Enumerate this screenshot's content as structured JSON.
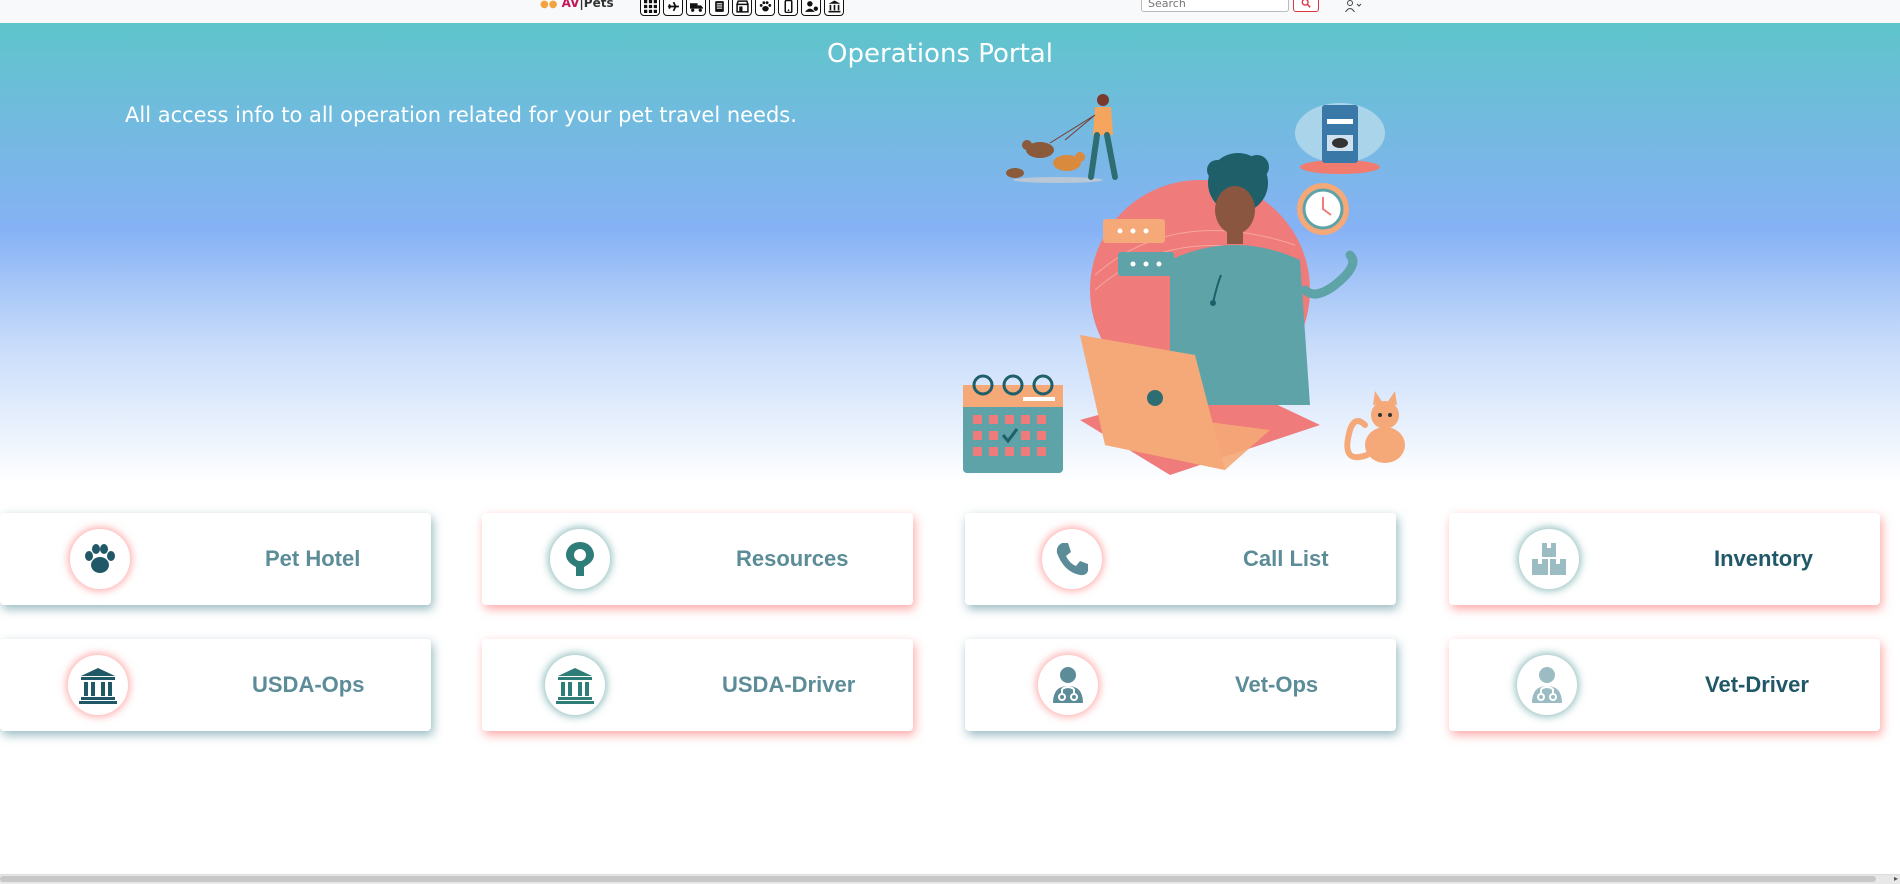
{
  "topbar": {
    "logo_prefix": "AV",
    "logo_text": "Pets",
    "search_placeholder": "Search",
    "nav_icons": [
      "grid-icon",
      "plane-icon",
      "truck-icon",
      "clipboard-icon",
      "shop-icon",
      "paw-icon",
      "phone-icon",
      "user-badge-icon",
      "bank-icon"
    ]
  },
  "hero": {
    "title": "Operations Portal",
    "subtitle": "All access info to all operation related for your pet travel needs."
  },
  "cards": [
    {
      "label": "Pet Hotel",
      "icon": "paw-icon"
    },
    {
      "label": "Resources",
      "icon": "location-pin-icon"
    },
    {
      "label": "Call List",
      "icon": "phone-icon"
    },
    {
      "label": "Inventory",
      "icon": "boxes-icon"
    },
    {
      "label": "USDA-Ops",
      "icon": "bank-icon"
    },
    {
      "label": "USDA-Driver",
      "icon": "bank-icon"
    },
    {
      "label": "Vet-Ops",
      "icon": "doctor-icon"
    },
    {
      "label": "Vet-Driver",
      "icon": "doctor-icon"
    }
  ],
  "colors": {
    "accent_teal": "#205867",
    "card_text": "#5c8c97",
    "hero_top": "#5ec5cb",
    "hero_mid": "#86b2f5",
    "search_button": "#dc3545"
  }
}
